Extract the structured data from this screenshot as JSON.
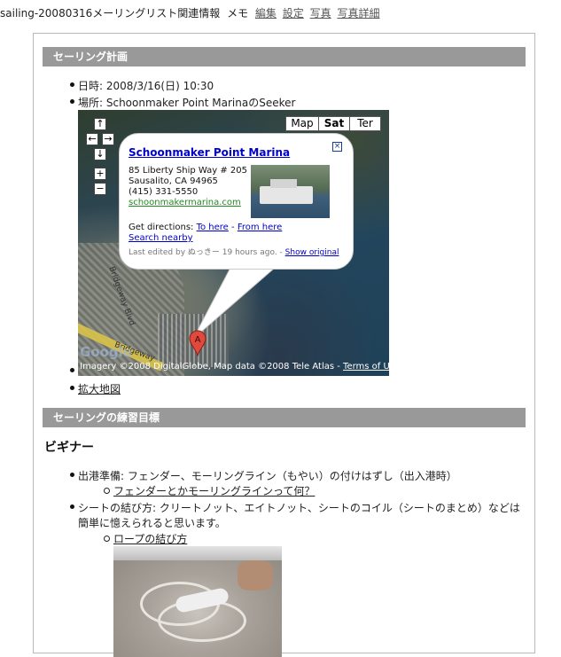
{
  "topbar": {
    "title": "sailing-20080316メーリングリスト関連情報",
    "memo": "メモ",
    "links": [
      "編集",
      "設定",
      "写真",
      "写真詳細"
    ]
  },
  "section1": {
    "heading": "セーリング計画",
    "date": "日時: 2008/3/16(日) 10:30",
    "place": "場所: Schoonmaker Point MarinaのSeeker",
    "map_link": "拡大地図"
  },
  "map": {
    "types": [
      "Map",
      "Sat",
      "Ter"
    ],
    "selected_type": "Sat",
    "controls": [
      "↑",
      "←",
      "→",
      "↓",
      "+",
      "−"
    ],
    "road_labels": [
      "Bridgeway Blvd",
      "Bridgeway"
    ],
    "google_logo": "Google",
    "copyright_prefix": "Imagery ©2008 DigitalGlobe, Map data ©2008 Tele Atlas - ",
    "terms_link": "Terms of Use",
    "marker": "A",
    "info": {
      "title": "Schoonmaker Point Marina",
      "address": [
        "85 Liberty Ship Way # 205",
        "Sausalito, CA 94965",
        "(415) 331-5550"
      ],
      "website": "schoonmakermarina.com",
      "directions_label": "Get directions:",
      "to_here": "To here",
      "separator": "-",
      "from_here": "From here",
      "search_nearby": "Search nearby",
      "edited_text": "Last edited by ぬっきー 19 hours ago. -",
      "show_original": "Show original",
      "close": "×"
    }
  },
  "section2": {
    "heading": "セーリングの練習目標",
    "subheading": "ビギナー",
    "item1": "出港準備: フェンダー、モーリングライン（もやい）の付けはずし（出入港時）",
    "item1_link": "フェンダーとかモーリングラインって何？",
    "item2_line1": "シートの結び方: クリートノット、エイトノット、シートのコイル（シートのまとめ）などは",
    "item2_line2": "簡単に憶えられると思います。",
    "item2_link": "ロープの結び方"
  }
}
